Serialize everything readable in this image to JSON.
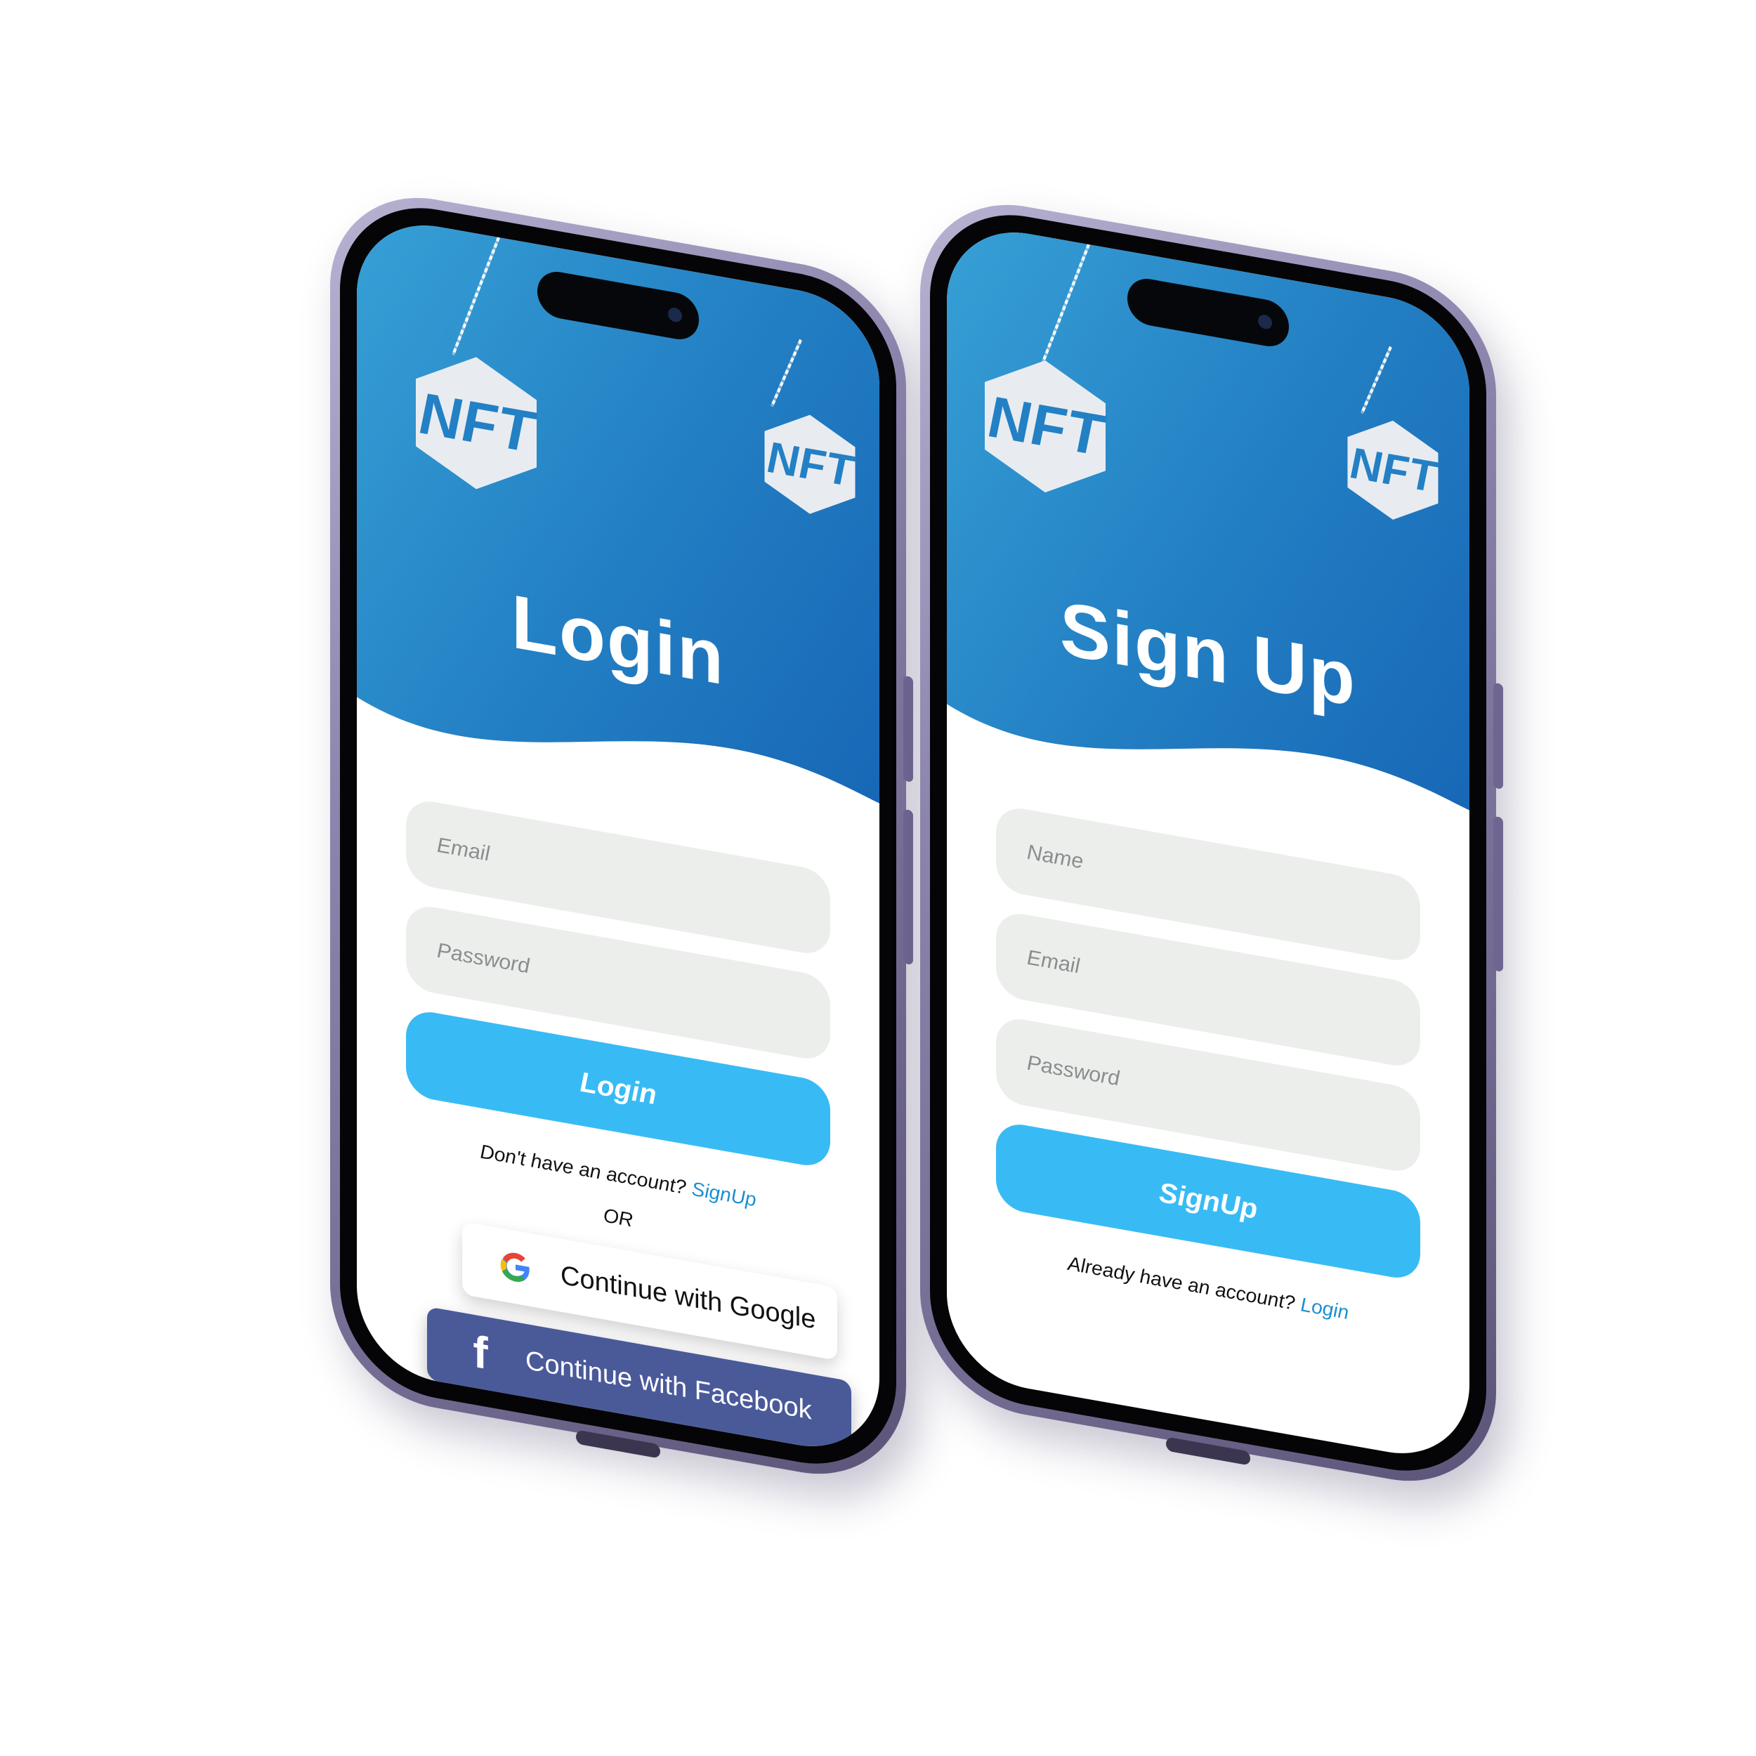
{
  "colors": {
    "header_start": "#37a0d6",
    "header_end": "#1766b5",
    "primary_button": "#38bbf4",
    "link": "#1c8fd0",
    "field_background": "#eceeec",
    "facebook": "#4a5a99",
    "phone_frame": "#8d85ad"
  },
  "badge_text": "NFT",
  "login_screen": {
    "title": "Login",
    "email_placeholder": "Email",
    "password_placeholder": "Password",
    "login_button": "Login",
    "signup_prompt": "Don't have an account?",
    "signup_link": "SignUp",
    "or_label": "OR",
    "google_button": "Continue with Google",
    "facebook_button": "Continue with Facebook",
    "icons": [
      "nft-badge-icon",
      "google-icon",
      "facebook-icon"
    ]
  },
  "signup_screen": {
    "title": "Sign Up",
    "name_placeholder": "Name",
    "email_placeholder": "Email",
    "password_placeholder": "Password",
    "signup_button": "SignUp",
    "login_prompt": "Already have an account?",
    "login_link": "Login",
    "icons": [
      "nft-badge-icon"
    ]
  }
}
